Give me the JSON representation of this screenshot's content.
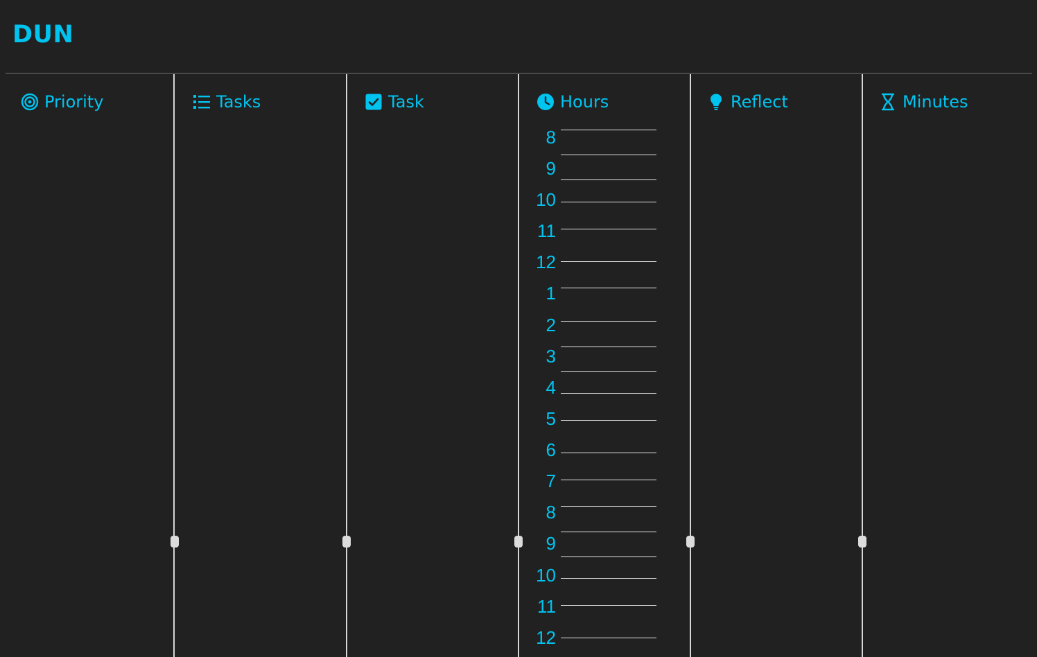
{
  "app": {
    "title": "DUN"
  },
  "columns": [
    {
      "label": "Priority",
      "icon": "target-icon"
    },
    {
      "label": "Tasks",
      "icon": "list-icon"
    },
    {
      "label": "Task",
      "icon": "checkbox-icon"
    },
    {
      "label": "Hours",
      "icon": "clock-icon"
    },
    {
      "label": "Reflect",
      "icon": "lightbulb-icon"
    },
    {
      "label": "Minutes",
      "icon": "hourglass-icon"
    }
  ],
  "hours": [
    "8",
    "9",
    "10",
    "11",
    "12",
    "1",
    "2",
    "3",
    "4",
    "5",
    "6",
    "7",
    "8",
    "9",
    "10",
    "11",
    "12"
  ],
  "colors": {
    "background": "#212121",
    "accent": "#00c4f0",
    "divider": "#d6d6d6",
    "rule": "#4a4a4a"
  }
}
